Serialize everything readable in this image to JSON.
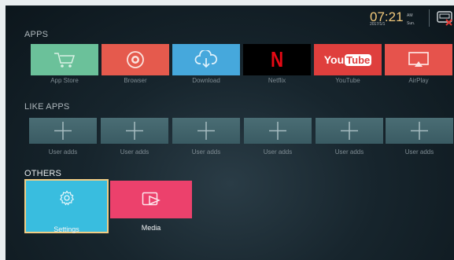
{
  "status": {
    "time": "07:21",
    "ampm": "AM",
    "date": "2017/1/1",
    "day": "Sun."
  },
  "sections": {
    "apps_title": "APPS",
    "like_apps_title": "LIKE APPS",
    "others_title": "OTHERS"
  },
  "apps": [
    {
      "label": "App Store",
      "color": "#6bc19a",
      "icon": "cart-icon"
    },
    {
      "label": "Browser",
      "color": "#e55a4d",
      "icon": "browser-icon"
    },
    {
      "label": "Download",
      "color": "#46a8dc",
      "icon": "cloud-download-icon"
    },
    {
      "label": "Netflix",
      "color": "#000000",
      "icon": "netflix-icon"
    },
    {
      "label": "YouTube",
      "color": "#df3f3d",
      "icon": "youtube-icon"
    },
    {
      "label": "AirPlay",
      "color": "#e6534c",
      "icon": "airplay-icon"
    }
  ],
  "youtube_text": {
    "you": "You",
    "tube": "Tube"
  },
  "netflix_text": "N",
  "like_apps": [
    {
      "label": "User adds"
    },
    {
      "label": "User adds"
    },
    {
      "label": "User adds"
    },
    {
      "label": "User adds"
    },
    {
      "label": "User adds"
    },
    {
      "label": "User adds"
    }
  ],
  "others": {
    "settings_label": "Settings",
    "media_label": "Media",
    "settings_color": "#39bddf",
    "media_color": "#ec416c",
    "selected_border": "#f1cd85"
  }
}
